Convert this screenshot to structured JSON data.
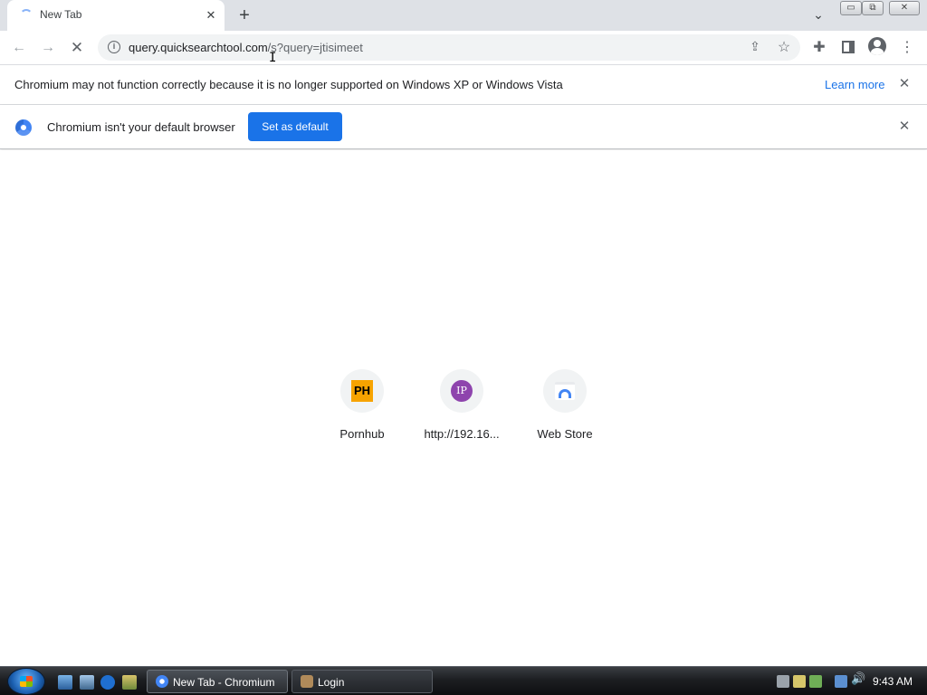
{
  "browser": {
    "tab": {
      "title": "New Tab"
    },
    "new_tab_label": "+",
    "window_controls": {
      "minimize": "▭",
      "maximize": "⧉",
      "close": "✕"
    },
    "toolbar": {
      "url_host": "query.quicksearchtool.com",
      "url_path": "/s?query=jtisimeet"
    },
    "infobar_unsupported": {
      "message": "Chromium may not function correctly because it is no longer supported on Windows XP or Windows Vista",
      "link_label": "Learn more"
    },
    "infobar_default": {
      "message": "Chromium isn't your default browser",
      "button_label": "Set as default"
    }
  },
  "ntp": {
    "tiles": [
      {
        "label": "Pornhub",
        "logo_text": "PH",
        "logo_color": "#f7a300"
      },
      {
        "label": "http://192.16...",
        "logo_text": "IP",
        "logo_color": "#8e44ad"
      },
      {
        "label": "Web Store"
      }
    ]
  },
  "taskbar": {
    "tasks": [
      {
        "label": "New Tab - Chromium"
      },
      {
        "label": "Login"
      }
    ],
    "clock": "9:43 AM"
  },
  "colors": {
    "accent": "#1a73e8",
    "tabstrip_bg": "#dee1e6",
    "omnibox_bg": "#f1f3f4"
  }
}
